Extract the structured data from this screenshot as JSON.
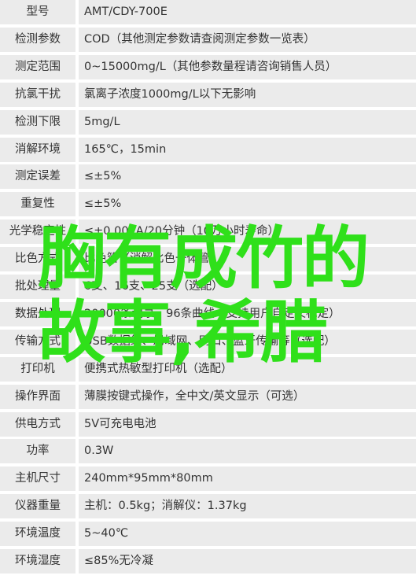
{
  "specs": [
    {
      "label": "型号",
      "value": "AMT/CDY-700E"
    },
    {
      "label": "检测参数",
      "value": "COD（其他测定参数请查阅测定参数一览表）"
    },
    {
      "label": "测定范围",
      "value": "0~15000mg/L（其他参数量程请咨询销售人员）"
    },
    {
      "label": "抗氯干扰",
      "value": "氯离子浓度1000mg/L以下无影响"
    },
    {
      "label": "检测下限",
      "value": "5mg/L"
    },
    {
      "label": "消解环境",
      "value": "165℃，15min"
    },
    {
      "label": "测定误差",
      "value": "≤±5%"
    },
    {
      "label": "重复性",
      "value": "≤±5%"
    },
    {
      "label": "光学稳定性",
      "value": "≤±0.001A/20分钟（10万小时寿命）"
    },
    {
      "label": "比色方式",
      "value": "比色管（消解比色一体管）"
    },
    {
      "label": "批处理量",
      "value": "6支、16支、25支（选配）"
    },
    {
      "label": "数据处理",
      "value": "20000条记录、96条曲线（支持用户自定义标定）"
    },
    {
      "label": "传输方式",
      "value": "USB数据线、局域网、网口、蓝牙传输等（选配）"
    },
    {
      "label": "打印机",
      "value": "便携式热敏型打印机（选配）"
    },
    {
      "label": "操作界面",
      "value": "薄膜按键式操作，全中文/英文显示（可选）"
    },
    {
      "label": "供电方式",
      "value": "5V可充电电池"
    },
    {
      "label": "功率",
      "value": "0.3W"
    },
    {
      "label": "主机尺寸",
      "value": "240mm*95mm*80mm"
    },
    {
      "label": "仪器重量",
      "value": "主机：0.5kg；消解仪：1.37kg"
    },
    {
      "label": "环境温度",
      "value": "5~40℃"
    },
    {
      "label": "环境湿度",
      "value": "≤85%无冷凝"
    }
  ],
  "overlay": {
    "line1": "胸有成竹的",
    "line2": "故事,希腊",
    "color": "#2fe01a"
  }
}
